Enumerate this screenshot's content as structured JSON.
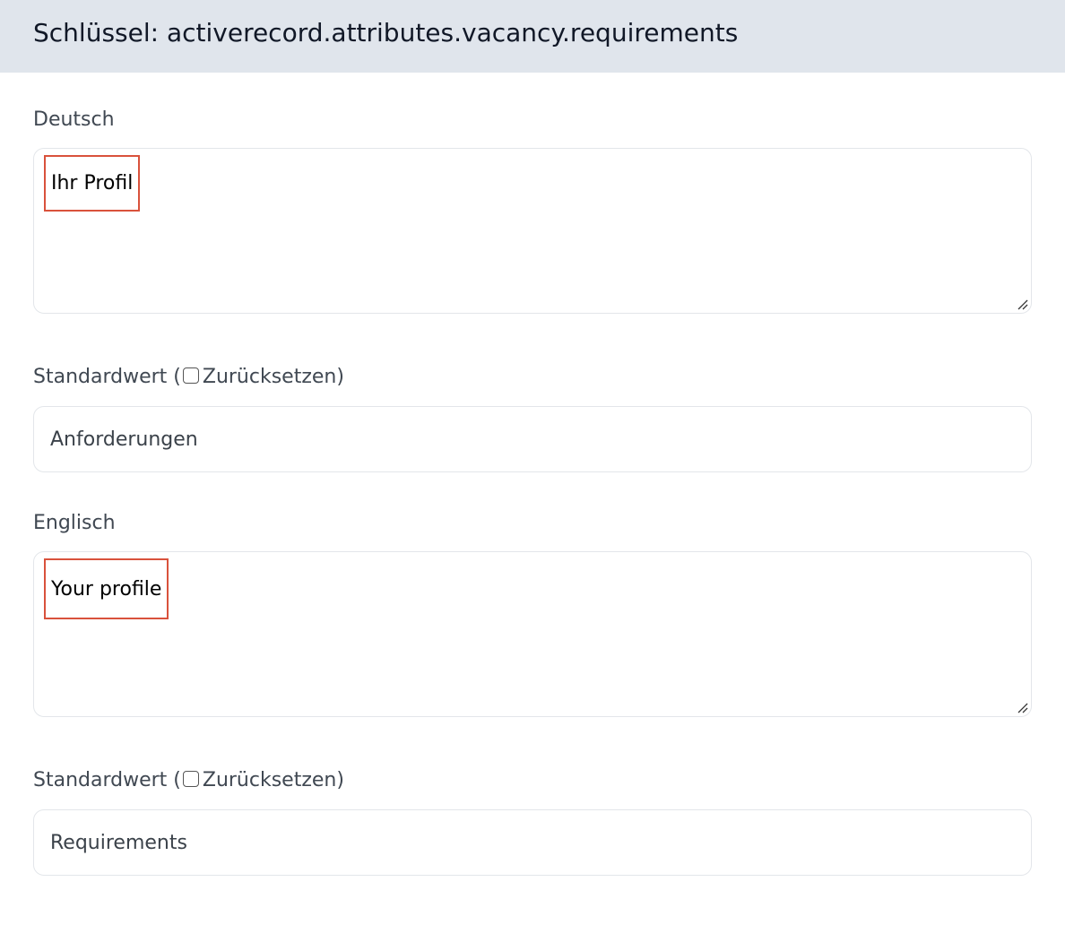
{
  "header": {
    "title": "Schlüssel: activerecord.attributes.vacancy.requirements"
  },
  "sections": [
    {
      "language_label": "Deutsch",
      "value": "Ihr Profil",
      "default_label_prefix": "Standardwert (",
      "reset_label": "Zurücksetzen)",
      "default_value": "Anforderungen"
    },
    {
      "language_label": "Englisch",
      "value": "Your profile",
      "default_label_prefix": "Standardwert (",
      "reset_label": "Zurücksetzen)",
      "default_value": "Requirements"
    }
  ],
  "colors": {
    "header_bg": "#e0e5ec",
    "highlight_border": "#d9523c",
    "field_border": "#e3e6ea"
  }
}
